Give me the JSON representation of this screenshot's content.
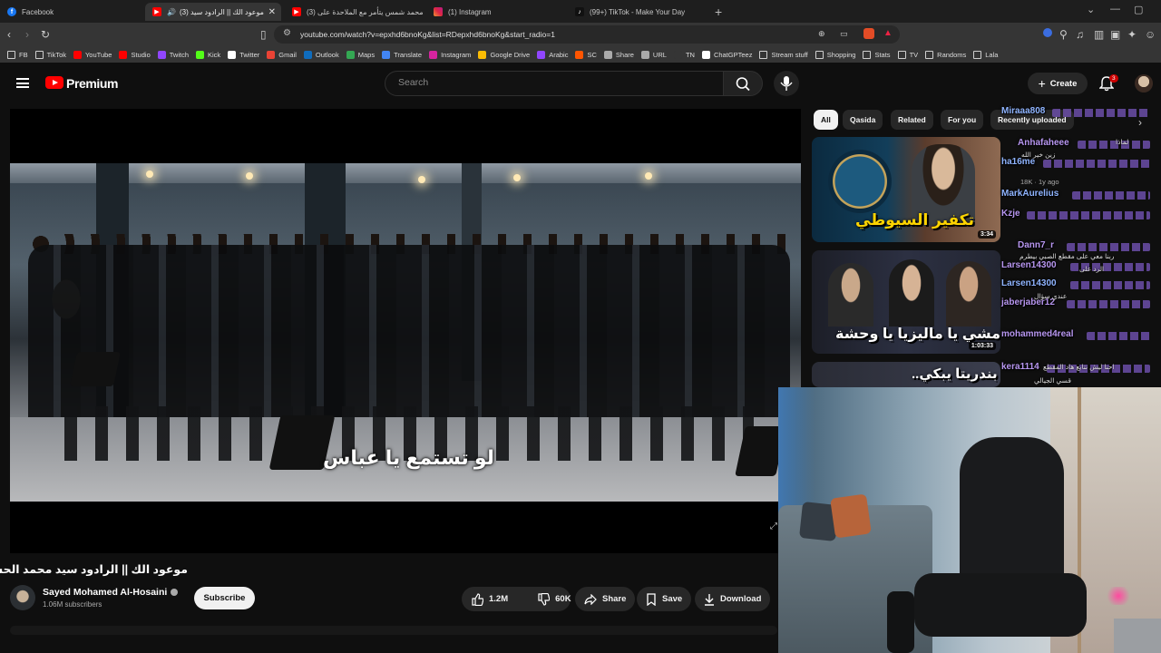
{
  "browser": {
    "tabs": [
      {
        "title": "Facebook",
        "active": false,
        "icon_color": "#1877f2"
      },
      {
        "title": "موعود الك || الرادود سيد (3)",
        "active": true,
        "icon_color": "#ff0000"
      },
      {
        "title": "(3) محمد شمس يتأمر مع الملاحدة على",
        "active": false,
        "icon_color": "#ff0000"
      },
      {
        "title": "(1) Instagram",
        "active": false,
        "icon_color": "#d6249f"
      },
      {
        "title": "(99+) TikTok - Make Your Day",
        "active": false,
        "icon_color": "#111111"
      }
    ],
    "url": "youtube.com/watch?v=epxhd6bnoKg&list=RDepxhd6bnoKg&start_radio=1",
    "bookmarks": [
      {
        "label": "FB",
        "icon": "folder-icon",
        "color": "#cfcfcf"
      },
      {
        "label": "TikTok",
        "icon": "folder-icon",
        "color": "#cfcfcf"
      },
      {
        "label": "YouTube",
        "icon": "youtube-icon",
        "color": "#ff0000"
      },
      {
        "label": "Studio",
        "icon": "youtube-studio-icon",
        "color": "#ff0000"
      },
      {
        "label": "Twitch",
        "icon": "twitch-icon",
        "color": "#9146ff"
      },
      {
        "label": "Kick",
        "icon": "kick-icon",
        "color": "#53fc18"
      },
      {
        "label": "Twitter",
        "icon": "x-icon",
        "color": "#ffffff"
      },
      {
        "label": "Gmail",
        "icon": "gmail-icon",
        "color": "#ea4335"
      },
      {
        "label": "Outlook",
        "icon": "outlook-icon",
        "color": "#0f6cbd"
      },
      {
        "label": "Maps",
        "icon": "maps-icon",
        "color": "#34a853"
      },
      {
        "label": "Translate",
        "icon": "translate-icon",
        "color": "#4285f4"
      },
      {
        "label": "Instagram",
        "icon": "instagram-icon",
        "color": "#d6249f"
      },
      {
        "label": "Google Drive",
        "icon": "drive-icon",
        "color": "#fbbc04"
      },
      {
        "label": "Arabic",
        "icon": "arabic-icon",
        "color": "#9146ff"
      },
      {
        "label": "SC",
        "icon": "sc-icon",
        "color": "#ff5500"
      },
      {
        "label": "Share",
        "icon": "share-icon",
        "color": "#aaaaaa"
      },
      {
        "label": "URL",
        "icon": "url-icon",
        "color": "#aaaaaa"
      },
      {
        "label": "TN",
        "icon": "tn-icon",
        "color": "#353535"
      },
      {
        "label": "ChatGPTeez",
        "icon": "chatgpt-icon",
        "color": "#ffffff"
      },
      {
        "label": "Stream stuff",
        "icon": "folder-icon",
        "color": "#cfcfcf"
      },
      {
        "label": "Shopping",
        "icon": "folder-icon",
        "color": "#cfcfcf"
      },
      {
        "label": "Stats",
        "icon": "folder-icon",
        "color": "#cfcfcf"
      },
      {
        "label": "TV",
        "icon": "folder-icon",
        "color": "#cfcfcf"
      },
      {
        "label": "Randoms",
        "icon": "folder-icon",
        "color": "#cfcfcf"
      },
      {
        "label": "Lala",
        "icon": "folder-icon",
        "color": "#cfcfcf"
      }
    ]
  },
  "youtube": {
    "brand": "Premium",
    "search_placeholder": "Search",
    "create_label": "Create",
    "notification_count": "3",
    "video": {
      "subtitle": "لو تستمع يا عباس",
      "title": "موعود الك || الرادود سيد محمد الحسيني ||",
      "channel": "Sayed Mohamed Al-Hosaini",
      "subscribers": "1.06M subscribers",
      "subscribe_label": "Subscribe",
      "likes": "1.2M",
      "dislikes": "60K",
      "share_label": "Share",
      "save_label": "Save",
      "download_label": "Download"
    },
    "chips": [
      "All",
      "Qasida",
      "Related",
      "For you",
      "Recently uploaded"
    ],
    "related": [
      {
        "overlay": "تكفير السيوطي",
        "duration": "3:34",
        "meta": "18K · 1y ago"
      },
      {
        "overlay": "امشي يا ماليزيا يا وحشة",
        "duration": "1:03:33",
        "meta": ""
      },
      {
        "overlay": "بندريتا يبكي..",
        "duration": "",
        "meta": ""
      }
    ]
  },
  "chat": [
    {
      "name": "Miraaa808",
      "color": "blue"
    },
    {
      "name": "Anhafaheee",
      "color": "purple"
    },
    {
      "name": "ha16me",
      "color": "blue"
    },
    {
      "name": "MarkAurelius",
      "color": "blue"
    },
    {
      "name": "Kzje",
      "color": "purple"
    },
    {
      "name": "Dann7_r",
      "color": "purple"
    },
    {
      "name": "Larsen14300",
      "color": "purple"
    },
    {
      "name": "Larsen14300",
      "color": "blue"
    },
    {
      "name": "jaberjaber12",
      "color": "purple"
    },
    {
      "name": "mohammed4real",
      "color": "purple"
    },
    {
      "name": "kera1114",
      "color": "purple"
    }
  ],
  "chat_text": [
    "لماذا",
    "زين خير الله",
    "ربنا معي على مقطع الصبي بيطرم",
    "الرد على",
    "احنا ليش نتابع هاد المقطع",
    "عندي سؤال",
    "قسي الجيالي"
  ]
}
